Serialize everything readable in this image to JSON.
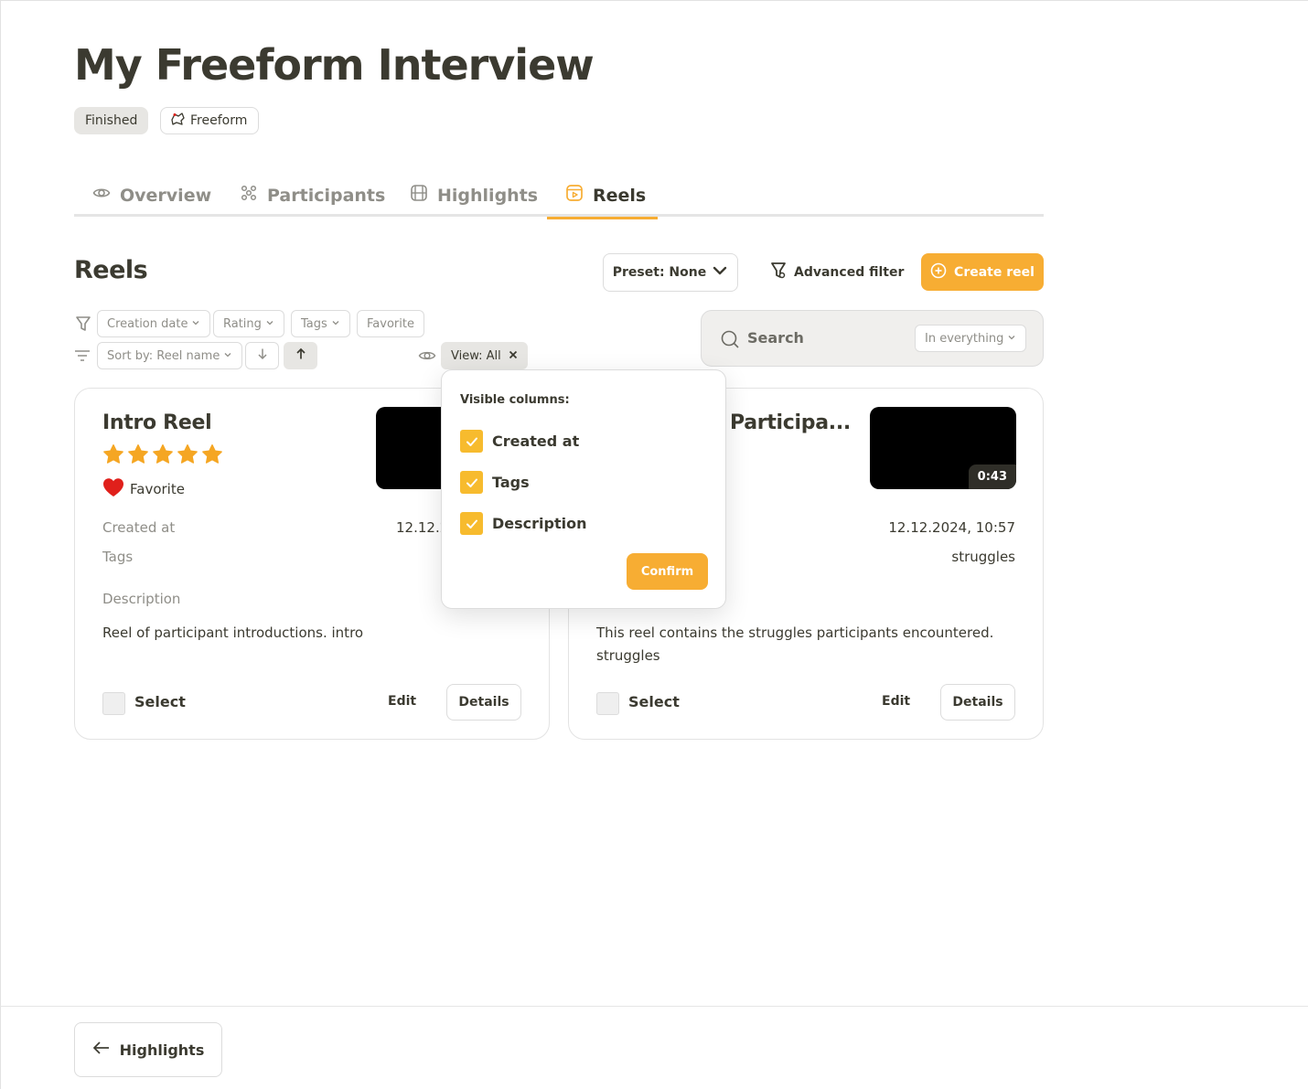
{
  "page": {
    "title": "My Freeform Interview",
    "status_badge": "Finished",
    "type_badge": "Freeform"
  },
  "tabs": [
    {
      "label": "Overview",
      "icon": "eye-icon",
      "active": false
    },
    {
      "label": "Participants",
      "icon": "participants-icon",
      "active": false
    },
    {
      "label": "Highlights",
      "icon": "film-icon",
      "active": false
    },
    {
      "label": "Reels",
      "icon": "reel-icon",
      "active": true
    }
  ],
  "section": {
    "title": "Reels",
    "preset_label": "Preset: None",
    "advanced_filter_label": "Advanced filter",
    "create_label": "Create reel"
  },
  "filters": {
    "chips": [
      "Creation date",
      "Rating",
      "Tags",
      "Favorite"
    ],
    "sort_label": "Sort by: Reel name",
    "view_label": "View: All"
  },
  "search": {
    "label": "Search",
    "scope": "In everything"
  },
  "cards": [
    {
      "title": "Intro Reel",
      "rating": 5,
      "favorite_label": "Favorite",
      "created_label": "Created at",
      "created_value": "12.12.2",
      "tags_label": "Tags",
      "tags_value": "",
      "description_label": "Description",
      "description": "Reel of participant introductions. intro",
      "duration": "",
      "select_label": "Select",
      "edit_label": "Edit",
      "details_label": "Details"
    },
    {
      "title": "Participa...",
      "created_value": "12.12.2024, 10:57",
      "tags_value": "struggles",
      "description": "This reel contains the struggles participants encountered. struggles",
      "duration": "0:43",
      "select_label": "Select",
      "edit_label": "Edit",
      "details_label": "Details"
    }
  ],
  "popup": {
    "title": "Visible columns:",
    "options": [
      {
        "label": "Created at",
        "checked": true
      },
      {
        "label": "Tags",
        "checked": true
      },
      {
        "label": "Description",
        "checked": true
      }
    ],
    "confirm_label": "Confirm"
  },
  "footer": {
    "back_label": "Highlights"
  },
  "colors": {
    "accent": "#f7ad33",
    "checkbox": "#f7bb2e",
    "text": "#3b3a30",
    "muted": "#8f8e88",
    "favorite": "#e0201b"
  }
}
